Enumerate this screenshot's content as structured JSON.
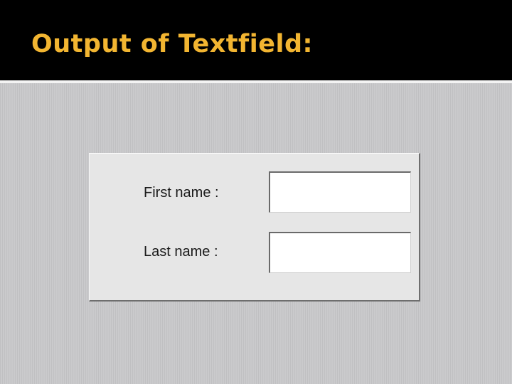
{
  "slide": {
    "title": "Output of  Textfield:"
  },
  "form": {
    "first_name": {
      "label": "First name :",
      "value": ""
    },
    "last_name": {
      "label": "Last name :",
      "value": ""
    }
  },
  "colors": {
    "title_text": "#f2b531",
    "title_background": "#000000",
    "content_background": "#c4c4c6",
    "panel_background": "#e6e6e6"
  }
}
